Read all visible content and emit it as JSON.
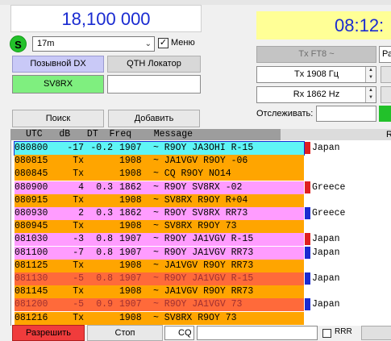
{
  "frequency": "18,100 000",
  "clock": "08:12:",
  "band": {
    "selected": "17m"
  },
  "menu": {
    "label": "Меню",
    "checked": true
  },
  "status_s": "S",
  "dx": {
    "call_label": "Позывной DX",
    "call_value": "SV8RX",
    "locator_label": "QTH Локатор",
    "locator_value": ""
  },
  "buttons": {
    "search": "Поиск",
    "add": "Добавить",
    "allow": "Разрешить",
    "stop": "Стоп"
  },
  "tx_mode": "Tx FT8 ~",
  "right_cut_field": "Ра",
  "tx_freq": "Tx  1908  Гц",
  "rx_freq": "Rx  1862  Hz",
  "track_label": "Отслеживать:",
  "table_header": {
    "cols": "UTC   dB   DT  Freq    Message",
    "right": "R"
  },
  "rows": [
    {
      "utc": "080800",
      "db": "-17",
      "dt": "-0.2",
      "freq": "1907",
      "msg": "~ R9OY JA3OHI R-15",
      "bg": "#5ff5f5",
      "fg": "#000000",
      "flag": "#e02020",
      "country": "Japan",
      "outline": true
    },
    {
      "utc": "080815",
      "db": "Tx",
      "dt": "",
      "freq": "1908",
      "msg": "~ JA1VGV R9OY -06",
      "bg": "#ffa500",
      "fg": "#000000",
      "flag": "",
      "country": ""
    },
    {
      "utc": "080845",
      "db": "Tx",
      "dt": "",
      "freq": "1908",
      "msg": "~ CQ R9OY NO14",
      "bg": "#ffa500",
      "fg": "#000000",
      "flag": "",
      "country": ""
    },
    {
      "utc": "080900",
      "db": "4",
      "dt": "0.3",
      "freq": "1862",
      "msg": "~ R9OY SV8RX -02",
      "bg": "#ff9cff",
      "fg": "#000000",
      "flag": "#e02020",
      "country": "Greece"
    },
    {
      "utc": "080915",
      "db": "Tx",
      "dt": "",
      "freq": "1908",
      "msg": "~ SV8RX R9OY R+04",
      "bg": "#ffa500",
      "fg": "#000000",
      "flag": "",
      "country": ""
    },
    {
      "utc": "080930",
      "db": "2",
      "dt": "0.3",
      "freq": "1862",
      "msg": "~ R9OY SV8RX RR73",
      "bg": "#ff9cff",
      "fg": "#000000",
      "flag": "#1a2bd1",
      "country": "Greece"
    },
    {
      "utc": "080945",
      "db": "Tx",
      "dt": "",
      "freq": "1908",
      "msg": "~ SV8RX R9OY 73",
      "bg": "#ffa500",
      "fg": "#000000",
      "flag": "",
      "country": ""
    },
    {
      "utc": "081030",
      "db": "-3",
      "dt": "0.8",
      "freq": "1907",
      "msg": "~ R9OY JA1VGV R-15",
      "bg": "#ff9cff",
      "fg": "#000000",
      "flag": "#e02020",
      "country": "Japan"
    },
    {
      "utc": "081100",
      "db": "-7",
      "dt": "0.8",
      "freq": "1907",
      "msg": "~ R9OY JA1VGV RR73",
      "bg": "#ff9cff",
      "fg": "#000000",
      "flag": "#1a2bd1",
      "country": "Japan"
    },
    {
      "utc": "081125",
      "db": "Tx",
      "dt": "",
      "freq": "1908",
      "msg": "~ JA1VGV R9OY RR73",
      "bg": "#ffa500",
      "fg": "#000000",
      "flag": "",
      "country": ""
    },
    {
      "utc": "081130",
      "db": "-5",
      "dt": "0.8",
      "freq": "1907",
      "msg": "~ R9OY JA1VGV R-15",
      "bg": "#ff6a3a",
      "fg": "#a03030",
      "flag": "#1a2bd1",
      "country": "Japan"
    },
    {
      "utc": "081145",
      "db": "Tx",
      "dt": "",
      "freq": "1908",
      "msg": "~ JA1VGV R9OY RR73",
      "bg": "#ffa500",
      "fg": "#000000",
      "flag": "",
      "country": ""
    },
    {
      "utc": "081200",
      "db": "-5",
      "dt": "0.9",
      "freq": "1907",
      "msg": "~ R9OY JA1VGV 73",
      "bg": "#ff6a3a",
      "fg": "#a03030",
      "flag": "#1a2bd1",
      "country": "Japan"
    },
    {
      "utc": "081216",
      "db": "Tx",
      "dt": "",
      "freq": "1908",
      "msg": "~ SV8RX R9OY 73",
      "bg": "#ffa500",
      "fg": "#000000",
      "flag": "",
      "country": ""
    }
  ],
  "bottom": {
    "cq": "CQ",
    "rr": "RRR"
  }
}
